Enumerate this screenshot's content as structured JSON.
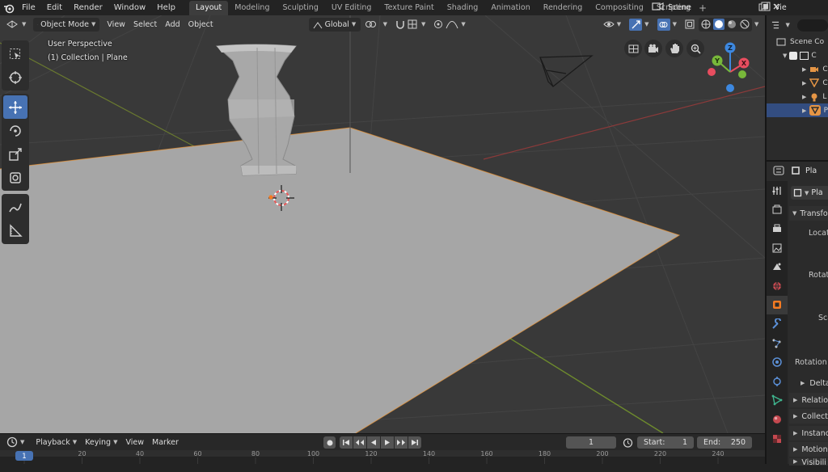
{
  "app": {
    "menus": [
      "File",
      "Edit",
      "Render",
      "Window",
      "Help"
    ],
    "workspaces": [
      "Layout",
      "Modeling",
      "Sculpting",
      "UV Editing",
      "Texture Paint",
      "Shading",
      "Animation",
      "Rendering",
      "Compositing",
      "Scripting"
    ],
    "active_workspace": "Layout",
    "scene_name": "Scene",
    "view_layer_label": "Vie"
  },
  "viewport": {
    "mode": "Object Mode",
    "menus": [
      "View",
      "Select",
      "Add",
      "Object"
    ],
    "transform_orientation": "Global",
    "overlay_title": "User Perspective",
    "overlay_subtitle": "(1) Collection | Plane",
    "gizmo_axes": {
      "x": "X",
      "y": "Y",
      "z": "Z"
    }
  },
  "toolbar": {
    "tools": [
      "select-box",
      "cursor",
      "move",
      "rotate",
      "scale",
      "transform",
      "annotate",
      "measure"
    ],
    "active_tool": "move"
  },
  "timeline": {
    "menus": [
      "Playback",
      "Keying",
      "View",
      "Marker"
    ],
    "current_frame": "1",
    "start_label": "Start:",
    "start_value": "1",
    "end_label": "End:",
    "end_value": "250",
    "ruler_ticks": [
      "0",
      "20",
      "40",
      "60",
      "80",
      "100",
      "120",
      "140",
      "160",
      "180",
      "200",
      "220",
      "240"
    ],
    "current_frame_marker": "1"
  },
  "outliner": {
    "title": "Scene Co",
    "rows": [
      "C",
      "C",
      "C",
      "L",
      "P"
    ]
  },
  "properties": {
    "object_name": "Pla",
    "data_name": "Pla",
    "section_transform": "Transfo",
    "labels": {
      "location": "Locati",
      "rotation": "Rotati",
      "scale": "Sca",
      "rotation_mode": "Rotation M"
    },
    "subsections": [
      "Delta",
      "Relatio",
      "Collecti",
      "Instanc",
      "Motion",
      "Visibili"
    ]
  },
  "colors": {
    "accent_blue": "#4772b3",
    "axis_x_red": "#e84d5f",
    "axis_y_green": "#78b83a",
    "axis_z_blue": "#3d88e0",
    "active_orange": "#f57b22",
    "plane_gray": "#a6a6a6"
  }
}
